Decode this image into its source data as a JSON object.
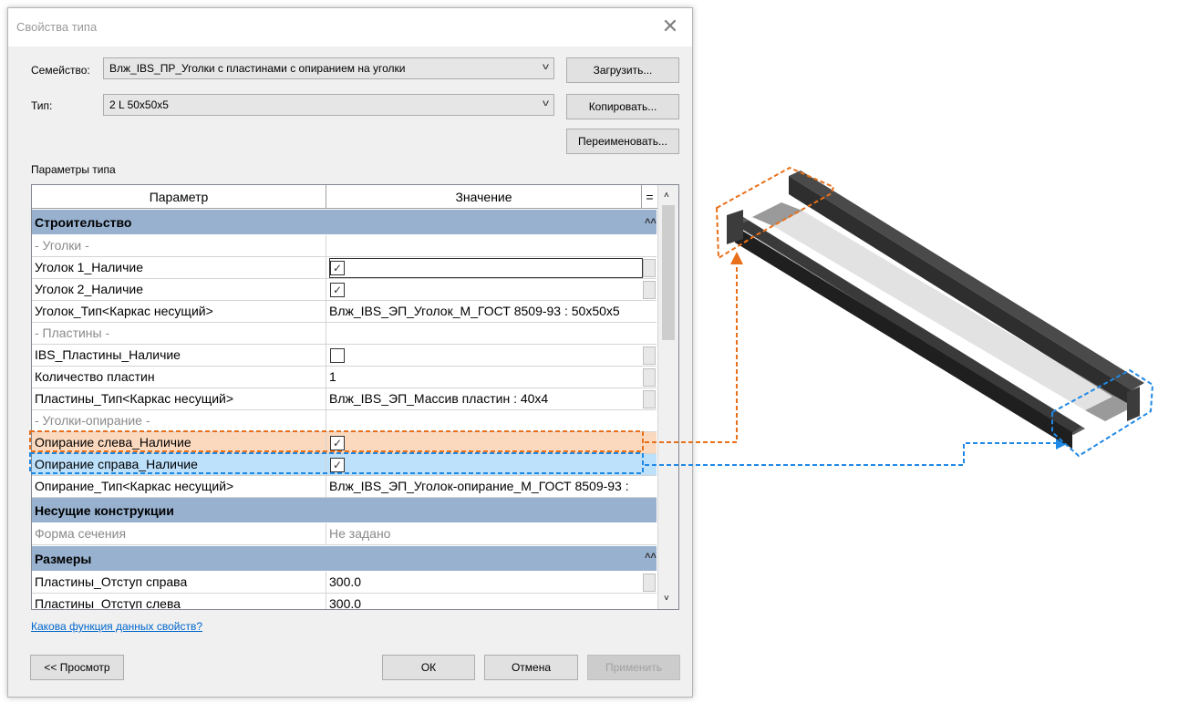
{
  "dialog": {
    "title": "Свойства типа",
    "close_glyph": "✕",
    "family_label": "Семейство:",
    "family_value": "Влж_IBS_ПР_Уголки с пластинами с опиранием на уголки",
    "type_label": "Тип:",
    "type_value": "2 L 50x50x5",
    "load_button": "Загрузить...",
    "copy_button": "Копировать...",
    "rename_button": "Переименовать...",
    "type_params_label": "Параметры типа",
    "help_link": "Какова функция данных свойств?",
    "preview_button": "<< Просмотр",
    "ok_button": "ОК",
    "cancel_button": "Отмена",
    "apply_button": "Применить"
  },
  "grid": {
    "col_param": "Параметр",
    "col_value": "Значение",
    "col_eq": "=",
    "group_construction": "Строительство",
    "sub_corners": "- Уголки -",
    "corner1": "Уголок 1_Наличие",
    "corner2": "Уголок 2_Наличие",
    "corner_type": "Уголок_Тип<Каркас несущий>",
    "corner_type_value": "Влж_IBS_ЭП_Уголок_М_ГОСТ 8509-93 : 50x50x5",
    "sub_plates": "- Пластины -",
    "plates_presence": "IBS_Пластины_Наличие",
    "plates_count": "Количество пластин",
    "plates_count_value": "1",
    "plates_type": "Пластины_Тип<Каркас несущий>",
    "plates_type_value": "Влж_IBS_ЭП_Массив пластин : 40x4",
    "sub_support": "- Уголки-опирание -",
    "support_left": "Опирание слева_Наличие",
    "support_right": "Опирание справа_Наличие",
    "support_type": "Опирание_Тип<Каркас несущий>",
    "support_type_value": "Влж_IBS_ЭП_Уголок-опирание_М_ГОСТ 8509-93 :",
    "group_structures": "Несущие конструкции",
    "section_shape": "Форма сечения",
    "section_shape_value": "Не задано",
    "group_dimensions": "Размеры",
    "plates_offset_right": "Пластины_Отступ справа",
    "plates_offset_right_value": "300.0",
    "plates_offset_left": "Пластины_Отступ слева",
    "plates_offset_left_value": "300.0"
  },
  "checks": {
    "corner1": true,
    "corner2": true,
    "plates": false,
    "support_left": true,
    "support_right": true
  },
  "colors": {
    "orange_highlight": "#e8701a",
    "blue_highlight": "#1e88e5",
    "group_header": "#97b1cf"
  }
}
